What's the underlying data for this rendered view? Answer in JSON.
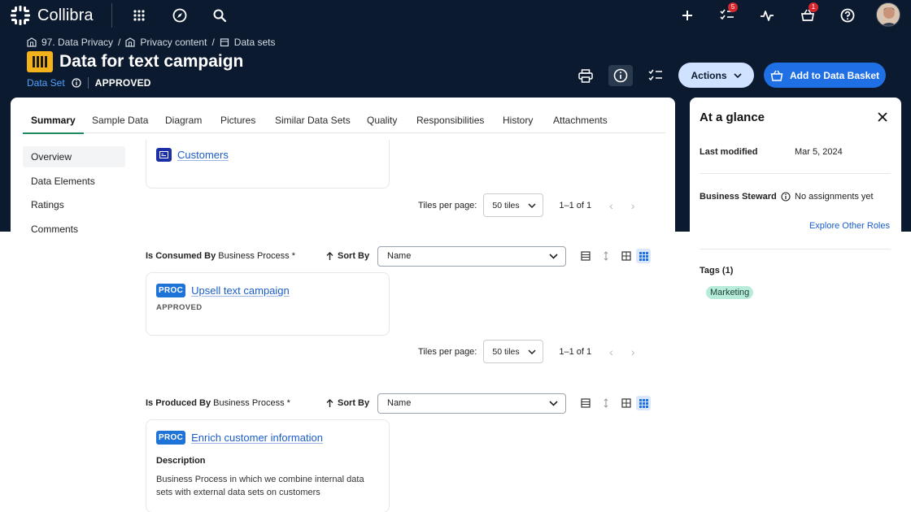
{
  "app": {
    "name": "Collibra",
    "brand_color": "#0b1a2e",
    "accent": "#1f6fe5"
  },
  "topbar": {
    "icons": [
      "apps-grid-icon",
      "compass-icon",
      "search-icon",
      "plus-icon",
      "tasks-icon",
      "activity-icon",
      "basket-icon",
      "help-icon"
    ],
    "tasks_badge": "5",
    "basket_badge": "1"
  },
  "breadcrumb": [
    "97. Data Privacy",
    "Privacy content",
    "Data sets"
  ],
  "breadcrumb_sep": "/",
  "asset": {
    "title": "Data for text campaign",
    "type": "Data Set",
    "status": "APPROVED"
  },
  "header_actions": {
    "actions_label": "Actions",
    "basket_label": "Add to Data Basket"
  },
  "tabs": [
    "Summary",
    "Sample Data",
    "Diagram",
    "Pictures",
    "Similar Data Sets",
    "Quality",
    "Responsibilities",
    "History",
    "Attachments"
  ],
  "subnav": [
    "Overview",
    "Data Elements",
    "Ratings",
    "Comments"
  ],
  "pager": {
    "label": "Tiles per page:",
    "value": "50 tiles",
    "range": "1–1 of 1"
  },
  "tile_customers": {
    "name": "Customers"
  },
  "consumed": {
    "title_bold": "Is Consumed By",
    "title_rest": "Business Process *",
    "sort_label": "Sort By",
    "sort_value": "Name",
    "tile": {
      "badge": "PROC",
      "name": "Upsell text campaign",
      "status": "APPROVED"
    }
  },
  "produced": {
    "title_bold": "Is Produced By",
    "title_rest": "Business Process *",
    "sort_label": "Sort By",
    "sort_value": "Name",
    "tile": {
      "badge": "PROC",
      "name": "Enrich customer information",
      "desc_title": "Description",
      "desc": "Business Process in which we combine internal data sets with external data sets on customers"
    }
  },
  "glance": {
    "title": "At a glance",
    "last_modified_label": "Last modified",
    "last_modified_value": "Mar 5, 2024",
    "steward_label": "Business Steward",
    "steward_value": "No assignments yet",
    "explore_link": "Explore Other Roles",
    "tags_label": "Tags (1)",
    "tag": "Marketing",
    "tag_color": "#b6ecd9"
  }
}
